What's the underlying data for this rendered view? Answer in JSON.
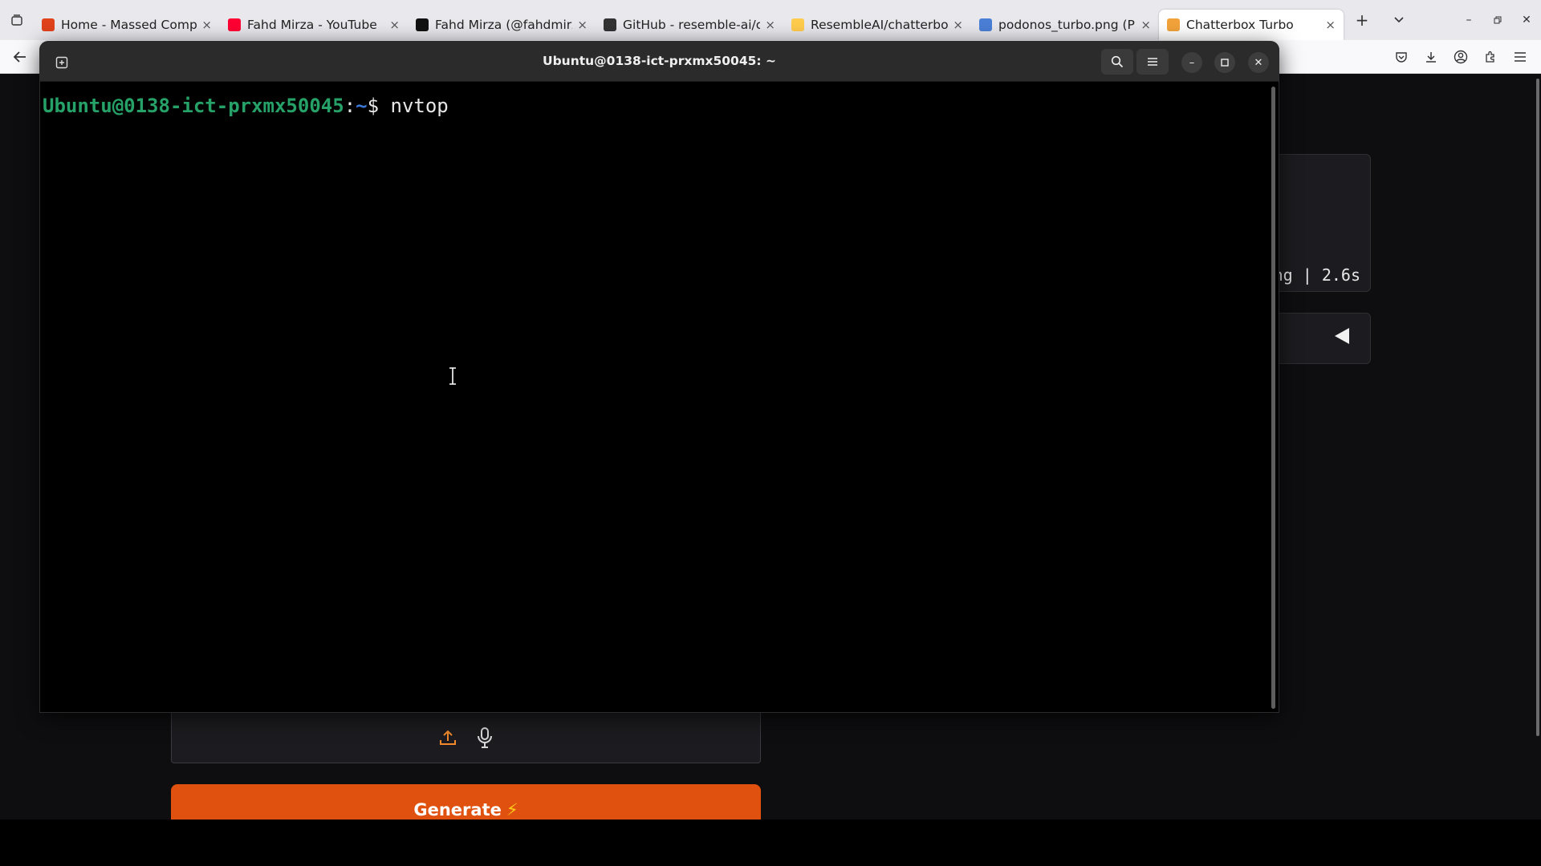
{
  "browser": {
    "tabs": [
      {
        "title": "Home - Massed Compute",
        "favicon": "massed-compute-icon",
        "favicon_color": "#e0421a",
        "active": false
      },
      {
        "title": "Fahd Mirza - YouTube",
        "favicon": "youtube-icon",
        "favicon_color": "#ff0033",
        "active": false
      },
      {
        "title": "Fahd Mirza (@fahdmirza)",
        "favicon": "x-icon",
        "favicon_color": "#111111",
        "active": false
      },
      {
        "title": "GitHub - resemble-ai/chatterbox",
        "favicon": "github-icon",
        "favicon_color": "#333333",
        "active": false
      },
      {
        "title": "ResembleAI/chatterbox-turbo",
        "favicon": "huggingface-icon",
        "favicon_color": "#ffcc4d",
        "active": false
      },
      {
        "title": "podonos_turbo.png (PNG Image)",
        "favicon": "image-icon",
        "favicon_color": "#4a7fd6",
        "active": false
      },
      {
        "title": "Chatterbox Turbo",
        "favicon": "gradio-icon",
        "favicon_color": "#f2a33a",
        "active": true
      }
    ],
    "new_tab_label": "+",
    "tab_close": "×"
  },
  "terminal": {
    "title": "Ubuntu@0138-ict-prxmx50045: ~",
    "prompt_user": "Ubuntu@0138-ict-prxmx50045",
    "prompt_sep": ":",
    "prompt_path": "~",
    "prompt_dollar": "$",
    "command": "nvtop"
  },
  "page": {
    "output_meta": "ng | 2.6s",
    "generate_label": "Generate",
    "generate_emoji": "⚡",
    "accent_color": "#e0510f"
  }
}
